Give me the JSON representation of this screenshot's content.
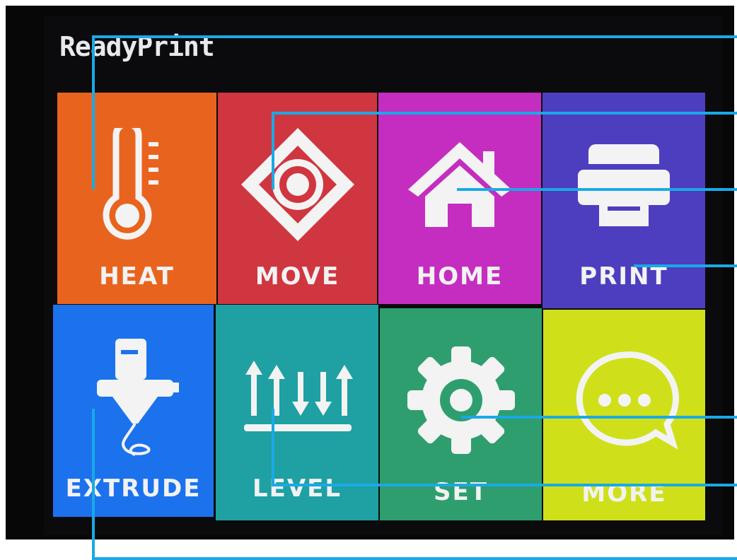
{
  "status_bar": {
    "title": "ReadyPrint"
  },
  "tiles": [
    {
      "label": "HEAT",
      "icon": "thermometer-icon",
      "color": "#e8641e"
    },
    {
      "label": "MOVE",
      "icon": "move-arrows-icon",
      "color": "#d0363f"
    },
    {
      "label": "HOME",
      "icon": "home-icon",
      "color": "#c52dc0"
    },
    {
      "label": "PRINT",
      "icon": "printer-icon",
      "color": "#4d3ec0"
    },
    {
      "label": "EXTRUDE",
      "icon": "extruder-icon",
      "color": "#1c72ed"
    },
    {
      "label": "LEVEL",
      "icon": "level-arrows-icon",
      "color": "#1fa0a3"
    },
    {
      "label": "SET",
      "icon": "gear-icon",
      "color": "#2f9e6f"
    },
    {
      "label": "MORE",
      "icon": "chat-bubble-icon",
      "color": "#cfe01a"
    }
  ],
  "callout_color": "#1aa9e6"
}
